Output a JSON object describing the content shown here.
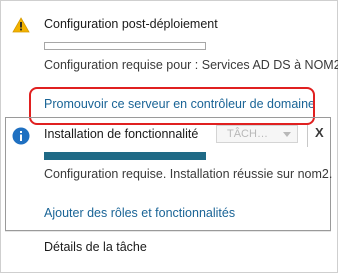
{
  "notifications": [
    {
      "title": "Configuration post-déploiement",
      "progress": 0,
      "status": "Configuration requise pour : Services AD DS à NOM2",
      "action_link": "Promouvoir ce serveur en contrôleur de domaine",
      "icon": "warning-icon"
    },
    {
      "title": "Installation de fonctionnalité",
      "progress": 1,
      "status": "Configuration requise. Installation réussie sur nom2.",
      "action_link": "Ajouter des rôles et fonctionnalités",
      "icon": "info-icon",
      "task_button": "TÂCH…",
      "close": "X"
    }
  ],
  "footer": {
    "task_details": "Détails de la tâche"
  },
  "colors": {
    "link": "#1a6496",
    "progress": "#1f6a86",
    "highlight": "#e02020",
    "warning": "#f2b200",
    "info": "#1f70c1"
  }
}
